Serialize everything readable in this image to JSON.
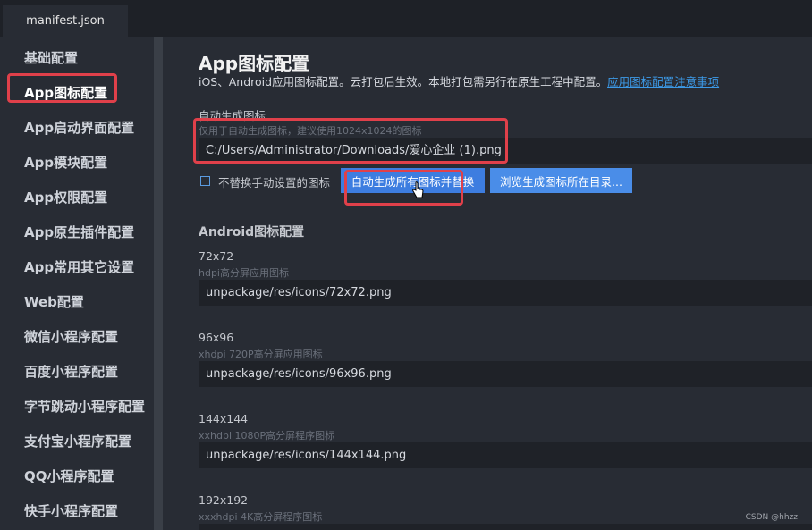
{
  "tab": {
    "title": "manifest.json"
  },
  "sidebar": {
    "items": [
      {
        "label": "基础配置"
      },
      {
        "label": "App图标配置"
      },
      {
        "label": "App启动界面配置"
      },
      {
        "label": "App模块配置"
      },
      {
        "label": "App权限配置"
      },
      {
        "label": "App原生插件配置"
      },
      {
        "label": "App常用其它设置"
      },
      {
        "label": "Web配置"
      },
      {
        "label": "微信小程序配置"
      },
      {
        "label": "百度小程序配置"
      },
      {
        "label": "字节跳动小程序配置"
      },
      {
        "label": "支付宝小程序配置"
      },
      {
        "label": "QQ小程序配置"
      },
      {
        "label": "快手小程序配置"
      }
    ],
    "active_index": 1
  },
  "main": {
    "title": "App图标配置",
    "description": "iOS、Android应用图标配置。云打包后生效。本地打包需另行在原生工程中配置。",
    "description_link": "应用图标配置注意事项",
    "auto_label": "自动生成图标",
    "auto_hint": "仅用于自动生成图标，建议使用1024x1024的图标",
    "auto_value": "C:/Users/Administrator/Downloads/爱心企业 (1).png",
    "checkbox_label": "不替换手动设置的图标",
    "checkbox_checked": false,
    "btn_generate": "自动生成所有图标并替换",
    "btn_browse": "浏览生成图标所在目录...",
    "android_section": "Android图标配置",
    "icons": [
      {
        "size": "72x72",
        "hint": "hdpi高分屏应用图标",
        "value": "unpackage/res/icons/72x72.png"
      },
      {
        "size": "96x96",
        "hint": "xhdpi 720P高分屏应用图标",
        "value": "unpackage/res/icons/96x96.png"
      },
      {
        "size": "144x144",
        "hint": "xxhdpi 1080P高分屏程序图标",
        "value": "unpackage/res/icons/144x144.png"
      },
      {
        "size": "192x192",
        "hint": "xxxhdpi 4K高分屏程序图标",
        "value": ""
      }
    ]
  },
  "watermark": "CSDN @hhzz",
  "colors": {
    "highlight": "#e0404a",
    "button": "#3d7de0",
    "link": "#3c9ae8",
    "background": "#282c34"
  }
}
